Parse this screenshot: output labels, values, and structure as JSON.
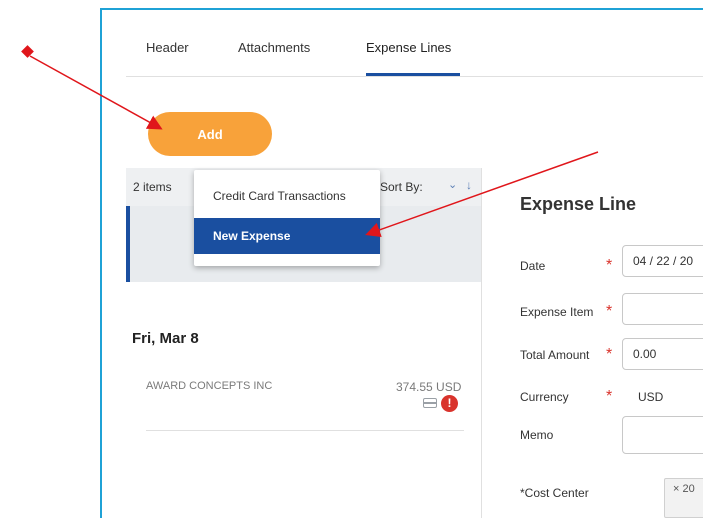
{
  "tabs": [
    {
      "label": "Header"
    },
    {
      "label": "Attachments"
    },
    {
      "label": "Expense Lines"
    }
  ],
  "add_button": {
    "label": "Add"
  },
  "list": {
    "items_count": "2 items",
    "sort_by": "Sort By:",
    "date_heading": "Fri, Mar 8",
    "row": {
      "merchant": "AWARD CONCEPTS INC",
      "amount": "374.55 USD"
    }
  },
  "dropdown": {
    "items": [
      {
        "label": "Credit Card Transactions"
      },
      {
        "label": "New Expense"
      }
    ]
  },
  "detail": {
    "title": "Expense Line",
    "fields": {
      "date": {
        "label": "Date",
        "value": "04 / 22 / 20"
      },
      "expense_item": {
        "label": "Expense Item",
        "value": ""
      },
      "total_amount": {
        "label": "Total Amount",
        "value": "0.00"
      },
      "currency": {
        "label": "Currency",
        "value": "USD"
      },
      "memo": {
        "label": "Memo",
        "value": ""
      },
      "cost_center": {
        "label": "*Cost Center",
        "value": "× 20"
      }
    }
  },
  "colors": {
    "accent": "#1a4fa0",
    "add_button": "#f8a23a",
    "required": "#d9332c",
    "annotation_arrow": "#e0161b",
    "frame_border": "#1fa2d6"
  }
}
